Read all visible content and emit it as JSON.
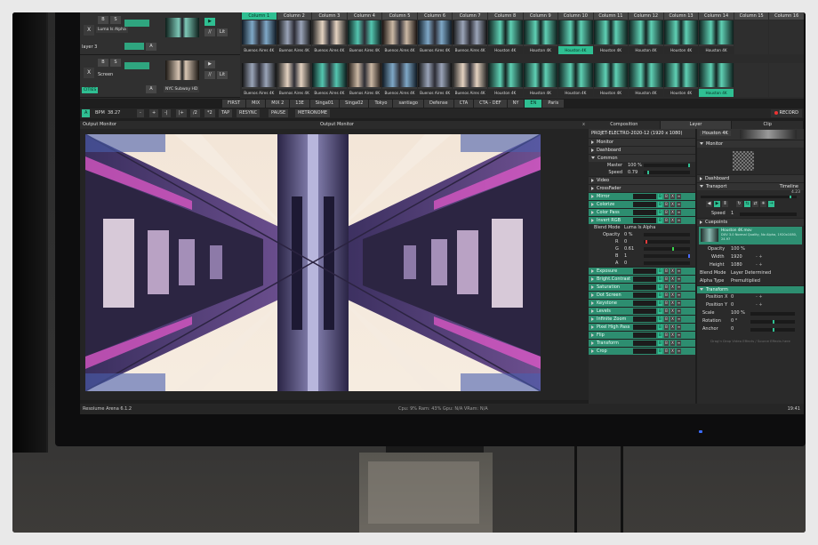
{
  "deck": {
    "columns": [
      "Column 1",
      "Column 2",
      "Column 3",
      "Column 4",
      "Column 5",
      "Column 6",
      "Column 7",
      "Column 8",
      "Column 9",
      "Column 10",
      "Column 11",
      "Column 12",
      "Column 13",
      "Column 14",
      "Column 15",
      "Column 16"
    ],
    "active_column": 0,
    "layers": [
      {
        "name": "layer 3",
        "clip_name": "Luma Is Alpha",
        "close": "X",
        "b": "B",
        "s": "S",
        "a": "A",
        "bpm": "//",
        "solo": "Lit",
        "clips": [
          "Buenos Aires 4K",
          "Buenos Aires 4K",
          "Buenos Aires 4K",
          "Buenos Aires 4K",
          "Buenos Aires 4K",
          "Buenos Aires 4K",
          "Buenos Aires 4K",
          "Houston 4K",
          "Houston 4K",
          "Houston 4K",
          "Houston 4K",
          "Houston 4K",
          "Houston 4K",
          "Houston 4K",
          "",
          ""
        ],
        "highlight": 9
      },
      {
        "name": "Screen",
        "clip_name": "NYC Subway HD",
        "layer_label": "CITIES",
        "close": "X",
        "b": "B",
        "s": "S",
        "a": "A",
        "bpm": "//",
        "solo": "Lit",
        "clips": [
          "Buenos Aires 4K",
          "Buenos Aires 4K",
          "Buenos Aires 4K",
          "Buenos Aires 4K",
          "Buenos Aires 4K",
          "Buenos Aires 4K",
          "Buenos Aires 4K",
          "Houston 4K",
          "Houston 4K",
          "Houston 4K",
          "Houston 4K",
          "Houston 4K",
          "Houston 4K",
          "Houston 4K",
          "",
          ""
        ],
        "highlight": 13
      }
    ]
  },
  "deck_tabs": [
    "FIRST",
    "MIX",
    "MIX 2",
    "13E",
    "Singa01",
    "Singa02",
    "Tokyo",
    "santiago",
    "Defense",
    "CTA",
    "CTA - DEF",
    "NY",
    "EN",
    "Paris"
  ],
  "active_deck_tab": 12,
  "bpm_bar": {
    "bpm_label": "BPM",
    "bpm_value": "38.27",
    "minus": "-",
    "plus": "+",
    "nudge_minus": "-|",
    "nudge_plus": "|+",
    "div": "/2",
    "mul": "*2",
    "tap": "TAP",
    "resync": "RESYNC",
    "pause": "PAUSE",
    "metronome": "METRONOME",
    "record": "RECORD"
  },
  "output": {
    "title_left": "Output Monitor",
    "title_center": "Output Monitor",
    "close": "x"
  },
  "right_tabs": {
    "composition": "Composition",
    "layer": "Layer",
    "clip": "Clip"
  },
  "layer_panel": {
    "title": "PROJET-ELECTRO-2020-12 (1920 x 1080)",
    "sections_top": [
      "Monitor",
      "Dashboard"
    ],
    "common": "Common",
    "master_label": "Master",
    "master_value": "100 %",
    "speed_label": "Speed",
    "speed_value": "0.79",
    "video": "Video",
    "crossfader": "CrossFader",
    "effects_a": [
      "Mirror",
      "Colorize",
      "Color Pass",
      "Invert RGB"
    ],
    "blend_label": "Blend Mode",
    "blend_value": "Luma Is Alpha",
    "opacity_label": "Opacity",
    "opacity_value": "0 %",
    "r_label": "R",
    "r_value": "0",
    "g_label": "G",
    "g_value": "0.61",
    "b_label": "B",
    "b_value": "1",
    "a_label": "A",
    "a_value": "0",
    "effects_b": [
      "Exposure",
      "Bright.Contrast",
      "Saturation",
      "Dot Screen",
      "Keystone",
      "Levels",
      "Infinite Zoom",
      "Pixel High Pass",
      "Flip",
      "Transform",
      "Crop"
    ],
    "btn_b": "B",
    "btn_x": "X",
    "btn_m": "≡"
  },
  "clip_panel": {
    "clip_name": "Houston 4K",
    "monitor": "Monitor",
    "dashboard": "Dashboard",
    "transport": "Transport",
    "transport_mode": "Timeline",
    "transport_value": "4.23",
    "speed_label": "Speed",
    "speed_value": "1",
    "cuepoints": "Cuepoints",
    "file_name": "Houston 4K.mov",
    "file_codec": "DXV 3.0 Normal Quality, No Alpha, 1920x1080, 24.97",
    "opacity_label": "Opacity",
    "opacity_value": "100 %",
    "width_label": "Width",
    "width_value": "1920",
    "height_label": "Height",
    "height_value": "1080",
    "blend_label": "Blend Mode",
    "blend_value": "Layer Determined",
    "alpha_label": "Alpha Type",
    "alpha_value": "Premultiplied",
    "transform": "Transform",
    "posx_label": "Position X",
    "posx_value": "0",
    "posy_label": "Position Y",
    "posy_value": "0",
    "scale_label": "Scale",
    "scale_value": "100 %",
    "rotation_label": "Rotation",
    "rotation_value": "0 °",
    "anchor_label": "Anchor",
    "anchor_value": "0",
    "hint": "Drag'n Drop Video Effects / Source Effects here",
    "pm": "-  +"
  },
  "status": {
    "app": "Resolume Arena 6.1.2",
    "stats": "Cpu: 9% Ram: 43% Gpu: N/A VRam: N/A",
    "time": "19:41"
  },
  "colors": {
    "accent": "#2fbf92",
    "panel": "#2a2a2a",
    "record": "#e33333"
  }
}
